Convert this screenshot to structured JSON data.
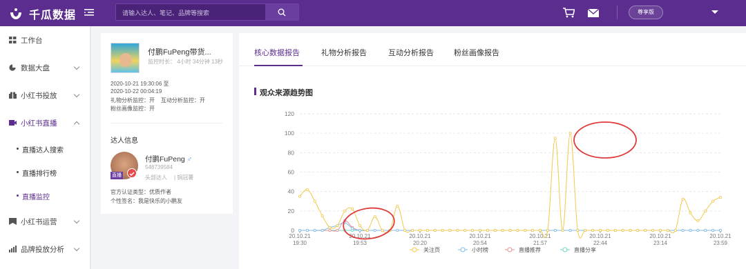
{
  "app": {
    "name": "千瓜数据",
    "plan": "尊享版"
  },
  "search": {
    "placeholder": "请输入达人、笔记、品牌等搜索"
  },
  "sidebar": {
    "items": [
      {
        "label": "工作台",
        "icon": "grid-icon"
      },
      {
        "label": "数据大盘",
        "icon": "pie-icon"
      },
      {
        "label": "小红书投放",
        "icon": "gift-icon"
      },
      {
        "label": "小红书直播",
        "icon": "video-icon"
      },
      {
        "label": "小红书运营",
        "icon": "bookmark-icon"
      },
      {
        "label": "品牌投放分析",
        "icon": "bar-chart-icon"
      }
    ],
    "sub_items": [
      "直播达人搜索",
      "直播排行榜",
      "直播监控"
    ]
  },
  "profile": {
    "title": "付鹏FuPeng带货...",
    "monitor_duration": "监控时长： 4小时 34分钟 13秒",
    "start": "2020-10-21 19:30:06 至",
    "end": "2020-10-22 00:04:19",
    "monitor_flags": "礼物分析监控：开    互动分析监控：开",
    "fans_monitor": "粉丝画像监控：开",
    "section": "达人信息",
    "kol_name": "付鹏FuPeng",
    "kol_gender": "♂",
    "kol_id": "548739584",
    "kol_tier": "头部达人",
    "kol_level": "| 铜冠薯",
    "live_tag": "直播",
    "cert": "官方认证类型：优质作者",
    "signature": "个性签名：我是快乐的小鹏友"
  },
  "tabs": [
    "核心数据报告",
    "礼物分析报告",
    "互动分析报告",
    "粉丝画像报告"
  ],
  "chart_title": "观众来源趋势图",
  "colors": {
    "brand": "#5b2d8e",
    "s1": "#f2c94c",
    "s2": "#7fbde8",
    "s3": "#e88e8e",
    "s4": "#6fd6c4",
    "annotation": "#e03b3b"
  },
  "chart_data": {
    "type": "line",
    "ylim": [
      0,
      120
    ],
    "yticks": [
      0,
      20,
      40,
      60,
      80,
      100,
      120
    ],
    "x_ticks": [
      {
        "d": "20.10.21",
        "t": "19:30"
      },
      {
        "d": "20.10.21",
        "t": "19:53"
      },
      {
        "d": "20.10.21",
        "t": "20:20"
      },
      {
        "d": "20.10.21",
        "t": "20:54"
      },
      {
        "d": "20.10.21",
        "t": "21:57"
      },
      {
        "d": "20.10.21",
        "t": "22:44"
      },
      {
        "d": "20.10.21",
        "t": "23:14"
      },
      {
        "d": "20.10.21",
        "t": "23:59"
      }
    ],
    "series": [
      {
        "name": "关注页",
        "values": [
          35,
          42,
          30,
          15,
          3,
          5,
          20,
          22,
          5,
          0,
          14,
          0,
          0,
          25,
          0,
          0,
          0,
          0,
          0,
          0,
          0,
          0,
          0,
          0,
          0,
          0,
          0,
          0,
          0,
          0,
          0,
          0,
          0,
          0,
          95,
          0,
          100,
          0,
          0,
          0,
          0,
          0,
          0,
          0,
          0,
          0,
          0,
          0,
          0,
          0,
          0,
          32,
          18,
          10,
          20,
          30,
          34
        ]
      },
      {
        "name": "小时榜",
        "values": [
          0,
          0,
          0,
          0,
          3,
          5,
          8,
          2,
          0,
          0,
          0,
          0,
          0,
          0,
          0,
          0,
          0,
          0,
          0,
          0,
          0,
          0,
          0,
          0,
          0,
          0,
          0,
          0,
          0,
          0,
          0,
          0,
          0,
          0,
          0,
          0,
          0,
          0,
          0,
          0,
          0,
          0,
          0,
          0,
          0,
          0,
          0,
          0,
          0,
          0,
          0,
          0,
          0,
          0,
          0,
          0,
          0
        ]
      },
      {
        "name": "直播推荐",
        "values": [
          0,
          0,
          0,
          0,
          0,
          0,
          10,
          3,
          0,
          0,
          0,
          0,
          0,
          0,
          0,
          0,
          0,
          0,
          0,
          0,
          0,
          0,
          0,
          0,
          0,
          0,
          0,
          0,
          0,
          0,
          0,
          0,
          0,
          0,
          0,
          0,
          0,
          0,
          0,
          0,
          0,
          0,
          0,
          0,
          0,
          0,
          0,
          0,
          0,
          0,
          0,
          0,
          0,
          0,
          0,
          0,
          0
        ]
      },
      {
        "name": "直播分享",
        "values": [
          0,
          0,
          0,
          0,
          0,
          0,
          0,
          0,
          0,
          0,
          0,
          0,
          0,
          0,
          0,
          0,
          0,
          0,
          0,
          0,
          0,
          0,
          0,
          0,
          0,
          0,
          0,
          0,
          0,
          0,
          0,
          0,
          0,
          0,
          0,
          0,
          0,
          0,
          0,
          0,
          0,
          0,
          0,
          0,
          0,
          0,
          0,
          0,
          0,
          0,
          0,
          0,
          0,
          0,
          0,
          0,
          0
        ]
      }
    ]
  }
}
